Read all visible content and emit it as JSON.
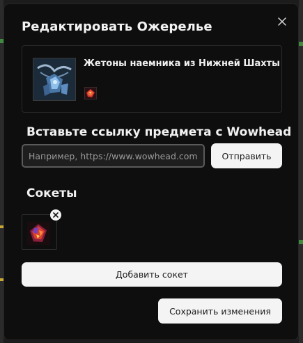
{
  "modal": {
    "title": "Редактировать Ожерелье",
    "close_icon": "close-icon"
  },
  "item": {
    "name": "Жетоны наемника из Нижней Шахты",
    "icon": "necklace-icon",
    "gem_icon": "ruby-gem-icon"
  },
  "wowhead": {
    "label": "Вставьте ссылку предмета с Wowhead",
    "input_value": "",
    "input_placeholder": "Например, https://www.wowhead.com",
    "send_label": "Отправить"
  },
  "sockets": {
    "label": "Сокеты",
    "items": [
      {
        "icon": "ruby-gem-icon",
        "remove_icon": "remove-socket-icon"
      }
    ],
    "add_label": "Добавить сокет"
  },
  "footer": {
    "save_label": "Сохранить изменения"
  },
  "colors": {
    "modal_bg": "#0e0e0e",
    "button_bg": "#f4f4f4",
    "button_text": "#1a1a1a",
    "input_border": "#5a5a5a"
  }
}
